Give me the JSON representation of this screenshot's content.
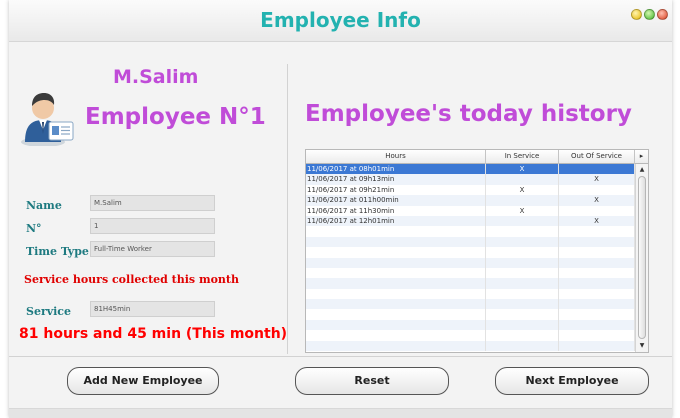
{
  "window": {
    "title": "Employee Info"
  },
  "profile": {
    "name": "M.Salim",
    "number_heading": "Employee N°1",
    "avatar_icon": "employee-avatar-icon"
  },
  "fields": {
    "name_label": "Name",
    "name_value": "M.Salim",
    "number_label": "N°",
    "number_value": "1",
    "time_type_label": "Time Type",
    "time_type_value": "Full-Time Worker",
    "service_label": "Service",
    "service_value": "81H45min"
  },
  "notes": {
    "collected": "Service hours collected this month",
    "total": "81 hours and 45 min (This month)"
  },
  "history": {
    "title": "Employee's today history",
    "columns": {
      "hours": "Hours",
      "in_service": "In Service",
      "out_of_service": "Out Of Service",
      "menu": "▸"
    },
    "rows": [
      {
        "hours": "11/06/2017 at 08h01min",
        "in": "X",
        "out": ""
      },
      {
        "hours": "11/06/2017 at 09h13min",
        "in": "",
        "out": "X"
      },
      {
        "hours": "11/06/2017 at 09h21min",
        "in": "X",
        "out": ""
      },
      {
        "hours": "11/06/2017 at 011h00min",
        "in": "",
        "out": "X"
      },
      {
        "hours": "11/06/2017 at 11h30min",
        "in": "X",
        "out": ""
      },
      {
        "hours": "11/06/2017 at 12h01min",
        "in": "",
        "out": "X"
      }
    ],
    "selected_row": 0
  },
  "buttons": {
    "add": "Add New Employee",
    "reset": "Reset",
    "next": "Next Employee"
  },
  "colors": {
    "title": "#23b2b0",
    "accent_purple": "#c04cd8",
    "label_teal": "#1e7a80",
    "alert_red": "#ff0000",
    "selection": "#3b78d4"
  }
}
